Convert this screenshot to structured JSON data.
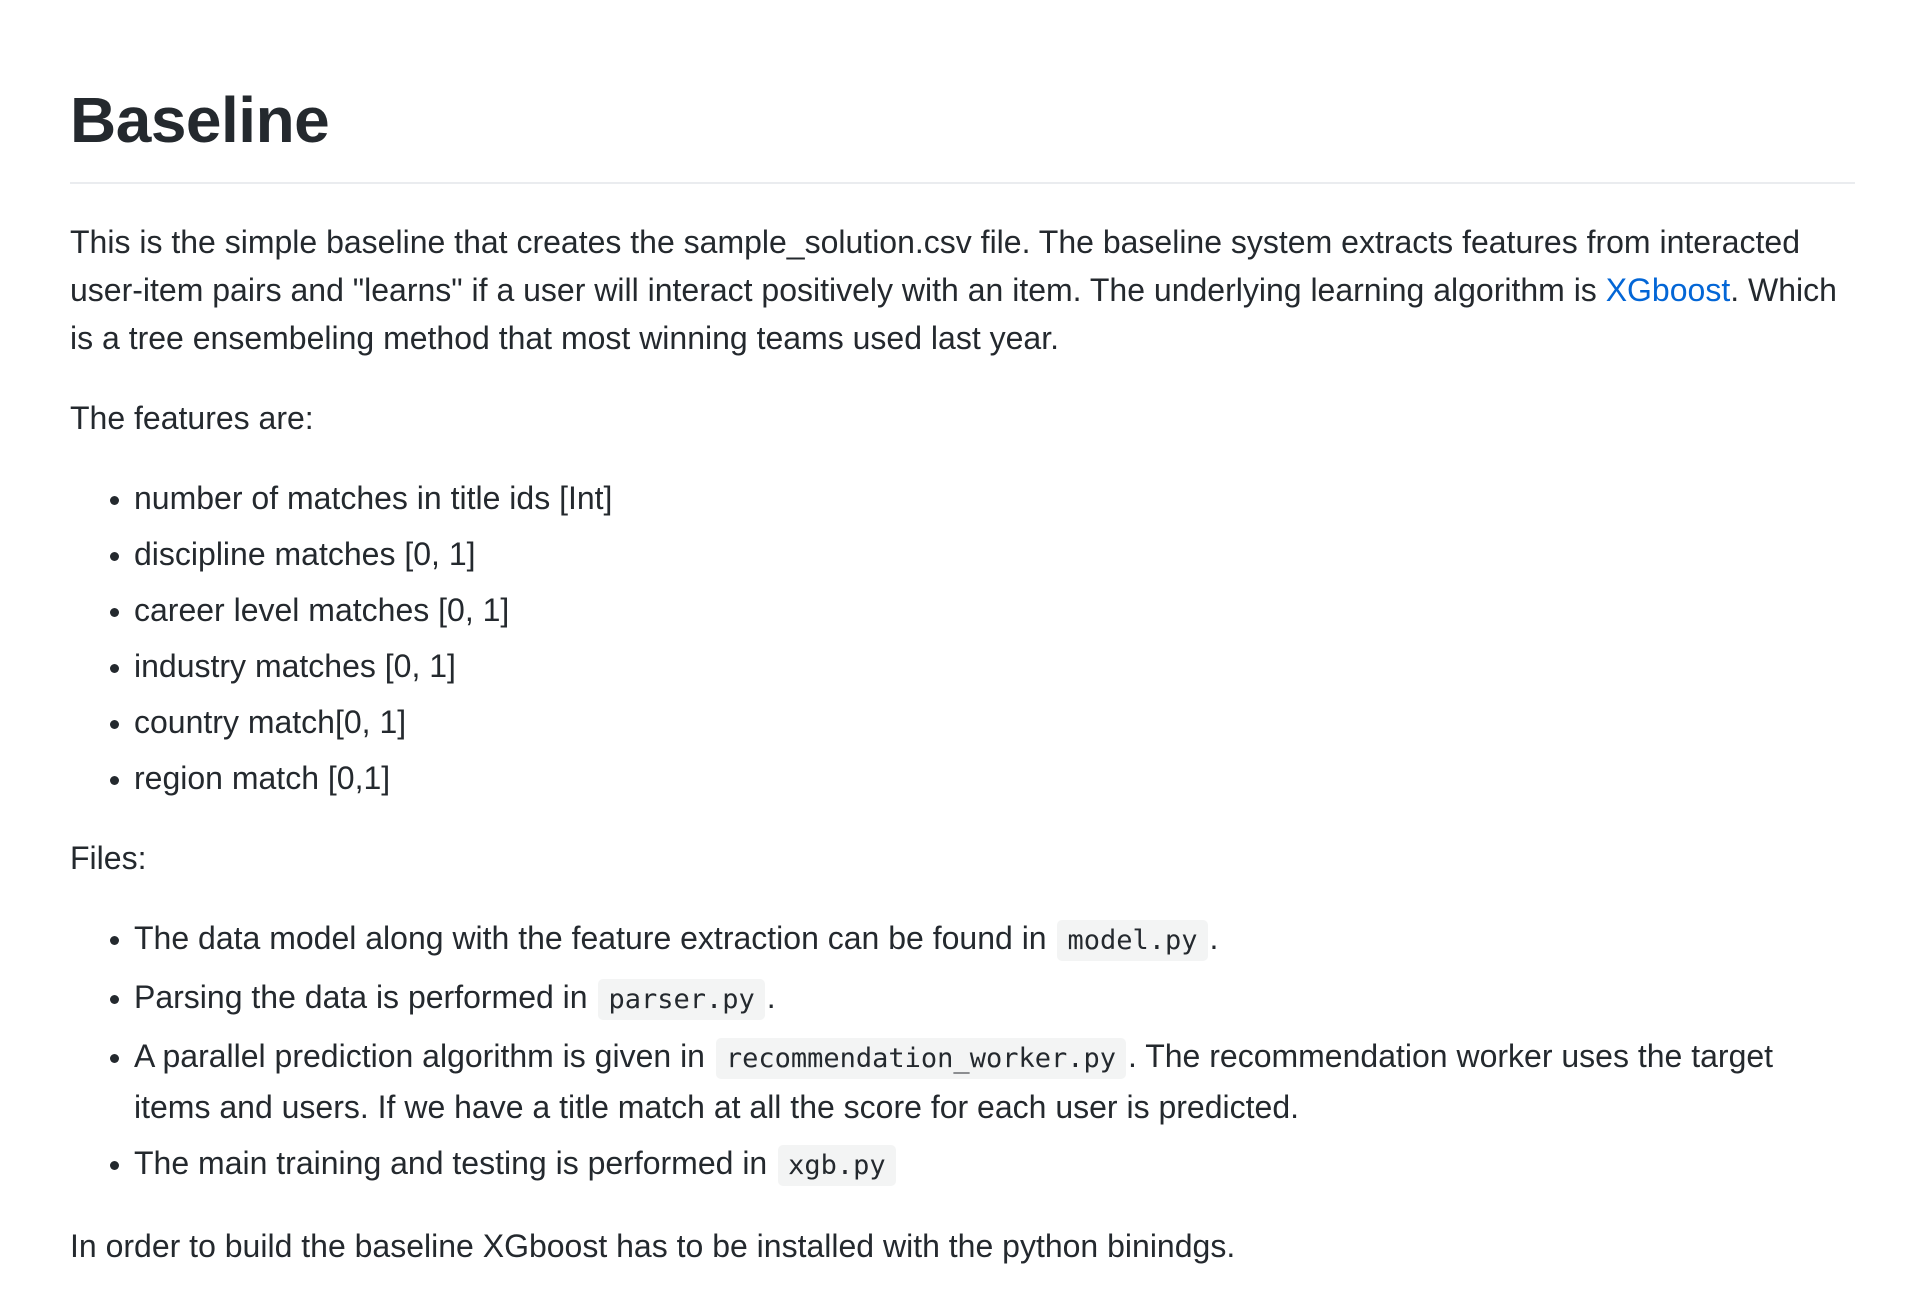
{
  "heading": "Baseline",
  "intro": {
    "part1": "This is the simple baseline that creates the sample_solution.csv file. The baseline system extracts features from interacted user-item pairs and \"learns\" if a user will interact positively with an item. The underlying learning algorithm is ",
    "link_text": "XGboost",
    "part2": ". Which is a tree ensembeling method that most winning teams used last year."
  },
  "features_heading": "The features are:",
  "features": [
    "number of matches in title ids [Int]",
    "discipline matches [0, 1]",
    "career level matches [0, 1]",
    "industry matches [0, 1]",
    "country match[0, 1]",
    "region match [0,1]"
  ],
  "files_heading": "Files:",
  "files": [
    {
      "before": "The data model along with the feature extraction can be found in ",
      "code": "model.py",
      "after": "."
    },
    {
      "before": "Parsing the data is performed in ",
      "code": "parser.py",
      "after": "."
    },
    {
      "before": "A parallel prediction algorithm is given in ",
      "code": "recommendation_worker.py",
      "after": ". The recommendation worker uses the target items and users. If we have a title match at all the score for each user is predicted."
    },
    {
      "before": "The main training and testing is performed in ",
      "code": "xgb.py",
      "after": ""
    }
  ],
  "closing": "In order to build the baseline XGboost has to be installed with the python binindgs.",
  "colors": {
    "text": "#24292e",
    "link": "#0366d6",
    "code_bg": "#f3f4f4",
    "rule": "#eaecef"
  }
}
